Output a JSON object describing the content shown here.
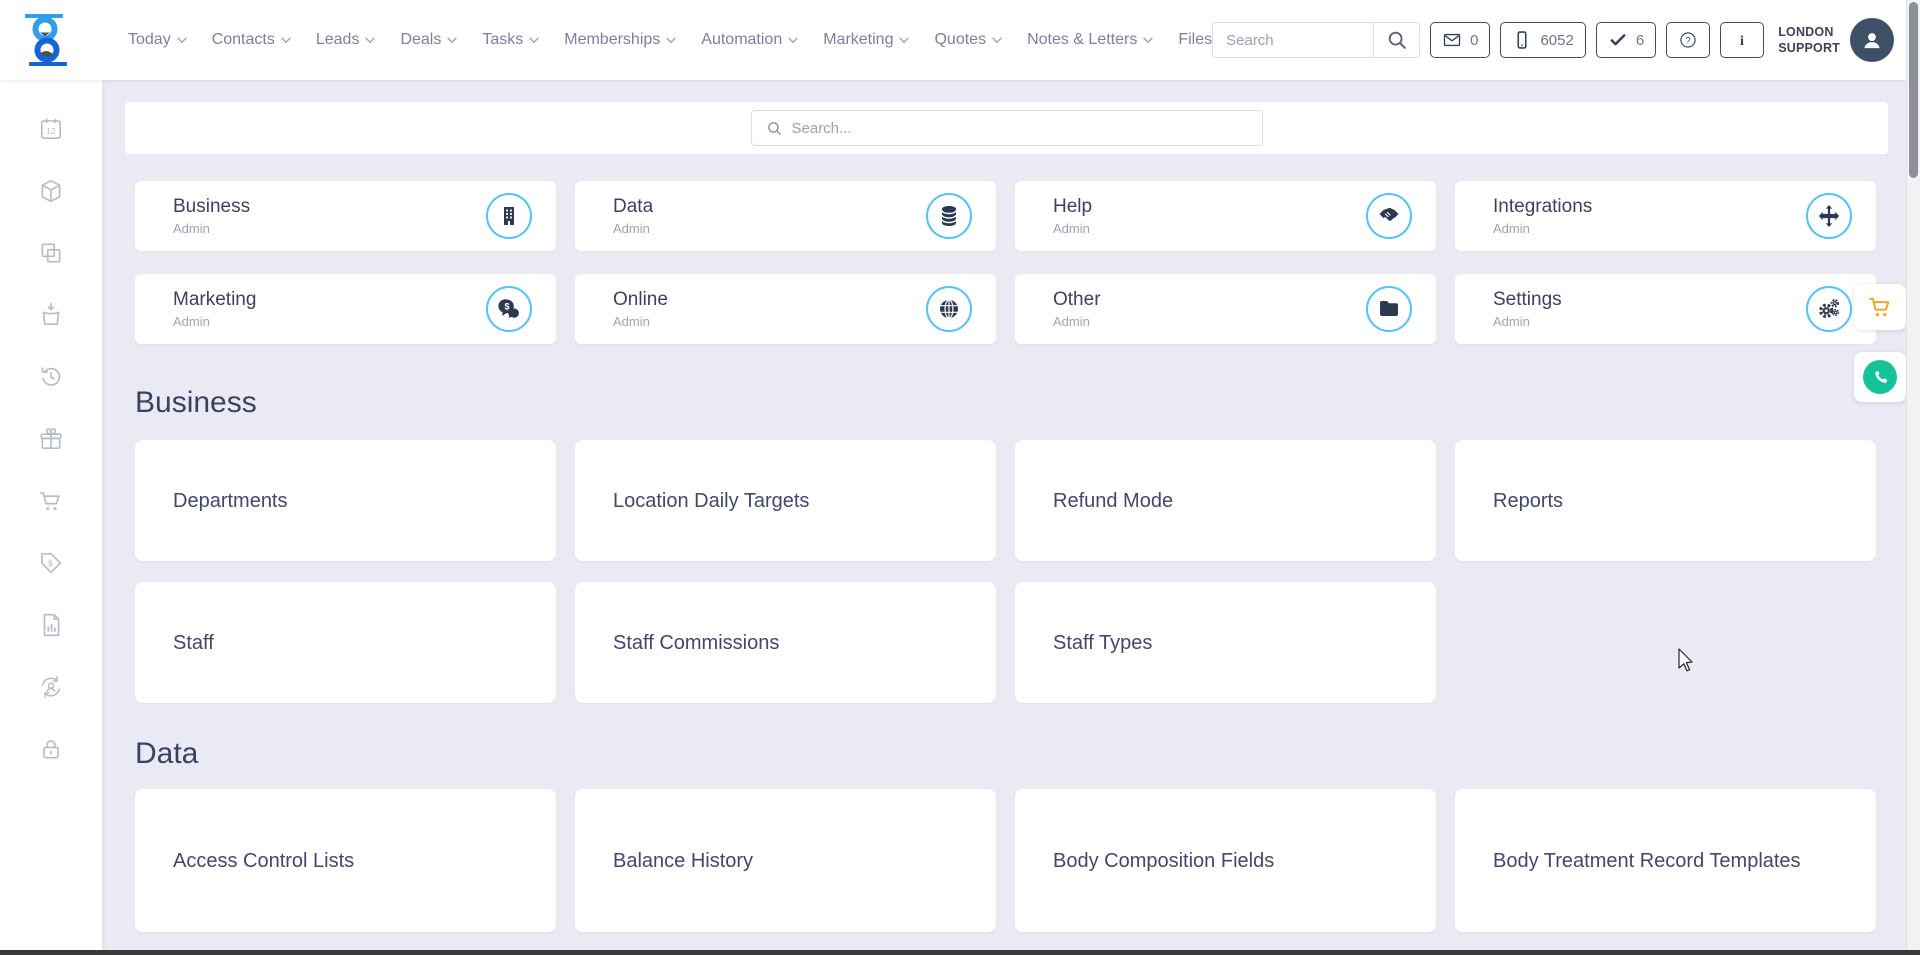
{
  "topbar": {
    "nav": [
      {
        "label": "Today",
        "chevron": true
      },
      {
        "label": "Contacts",
        "chevron": true
      },
      {
        "label": "Leads",
        "chevron": true
      },
      {
        "label": "Deals",
        "chevron": true
      },
      {
        "label": "Tasks",
        "chevron": true
      },
      {
        "label": "Memberships",
        "chevron": true
      },
      {
        "label": "Automation",
        "chevron": true
      },
      {
        "label": "Marketing",
        "chevron": true
      },
      {
        "label": "Quotes",
        "chevron": true
      },
      {
        "label": "Notes & Letters",
        "chevron": true
      },
      {
        "label": "Files",
        "chevron": false
      }
    ],
    "search_placeholder": "Search",
    "badges": [
      {
        "name": "messages",
        "icon": "envelope-icon",
        "value": "0"
      },
      {
        "name": "calls",
        "icon": "phone-icon",
        "value": "6052"
      },
      {
        "name": "tasks",
        "icon": "check-icon",
        "value": "6"
      },
      {
        "name": "help",
        "icon": "question-icon"
      },
      {
        "name": "info",
        "icon": "info-icon"
      }
    ],
    "user": {
      "name_line1": "LONDON",
      "name_line2": "SUPPORT"
    }
  },
  "sidebar": {
    "items": [
      "calendar",
      "package",
      "copy",
      "bag-download",
      "history",
      "gift",
      "cart",
      "price-tag",
      "report",
      "account-sync",
      "lock"
    ]
  },
  "content": {
    "search_placeholder": "Search...",
    "admin_cards": [
      {
        "title": "Business",
        "subtitle": "Admin",
        "icon": "building"
      },
      {
        "title": "Data",
        "subtitle": "Admin",
        "icon": "database"
      },
      {
        "title": "Help",
        "subtitle": "Admin",
        "icon": "handshake"
      },
      {
        "title": "Integrations",
        "subtitle": "Admin",
        "icon": "move-arrows"
      },
      {
        "title": "Marketing",
        "subtitle": "Admin",
        "icon": "chat-dollar"
      },
      {
        "title": "Online",
        "subtitle": "Admin",
        "icon": "globe"
      },
      {
        "title": "Other",
        "subtitle": "Admin",
        "icon": "folder"
      },
      {
        "title": "Settings",
        "subtitle": "Admin",
        "icon": "gears"
      }
    ],
    "sections": [
      {
        "title": "Business",
        "tiles": [
          "Departments",
          "Location Daily Targets",
          "Refund Mode",
          "Reports",
          "Staff",
          "Staff Commissions",
          "Staff Types"
        ]
      },
      {
        "title": "Data",
        "tiles": [
          "Access Control Lists",
          "Balance History",
          "Body Composition Fields",
          "Body Treatment Record Templates"
        ]
      }
    ]
  },
  "colors": {
    "accent_blue": "#55c3f2",
    "icon_navy": "#2c3950",
    "cart_orange": "#f5a31c",
    "whatsapp_teal": "#15c39a",
    "background": "#e9eaf3",
    "text_navy": "#3d4161"
  }
}
